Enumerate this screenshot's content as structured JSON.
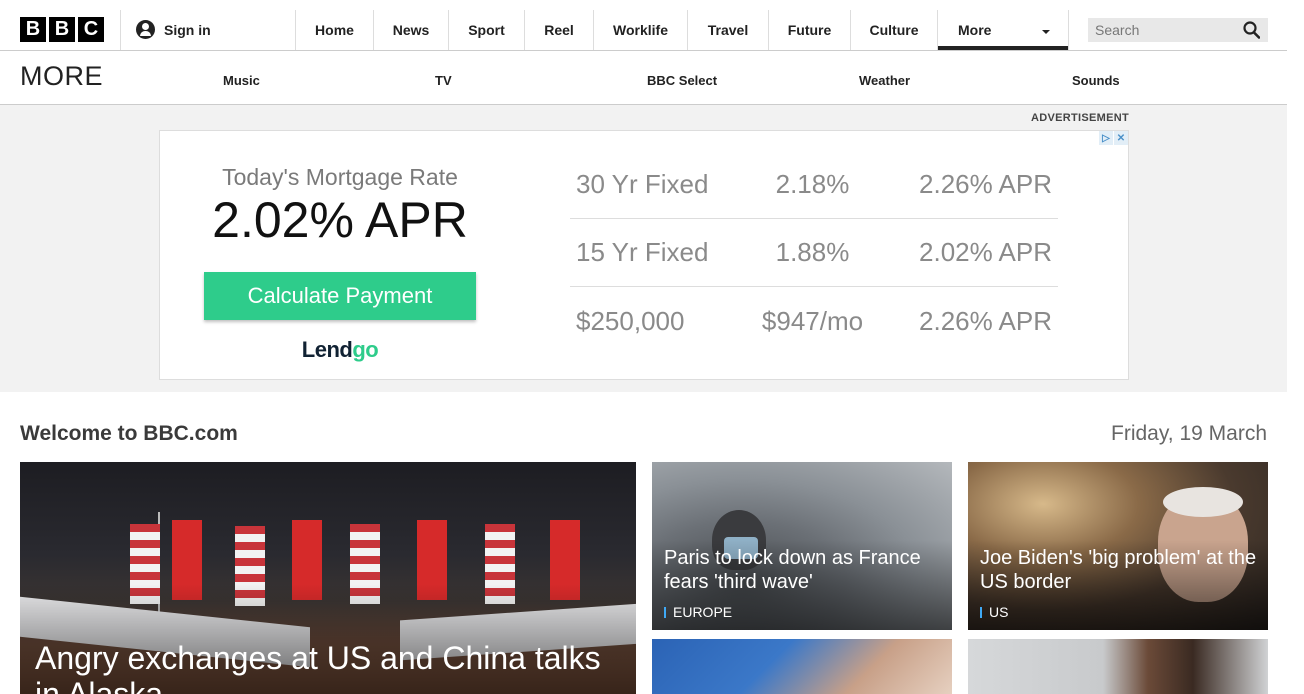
{
  "header": {
    "logo_letters": [
      "B",
      "B",
      "C"
    ],
    "signin_label": "Sign in",
    "nav": [
      "Home",
      "News",
      "Sport",
      "Reel",
      "Worklife",
      "Travel",
      "Future",
      "Culture",
      "More"
    ],
    "search_placeholder": "Search"
  },
  "subnav": {
    "title": "MORE",
    "links": [
      "Music",
      "TV",
      "BBC Select",
      "Weather",
      "Sounds"
    ]
  },
  "ad": {
    "label": "ADVERTISEMENT",
    "heading": "Today's Mortgage Rate",
    "rate": "2.02% APR",
    "button": "Calculate Payment",
    "brand_part1": "Lend",
    "brand_part2": "go",
    "rows": [
      [
        "30 Yr Fixed",
        "2.18%",
        "2.26% APR"
      ],
      [
        "15 Yr Fixed",
        "1.88%",
        "2.02% APR"
      ],
      [
        "$250,000",
        "$947/mo",
        "2.26% APR"
      ]
    ]
  },
  "main": {
    "welcome": "Welcome to BBC.com",
    "date": "Friday, 19 March",
    "stories": [
      {
        "headline": "Angry exchanges at US and China talks in Alaska"
      },
      {
        "headline": "Paris to lock down as France fears 'third wave'",
        "tag": "EUROPE"
      },
      {
        "headline": "Joe Biden's 'big problem' at the US border",
        "tag": "US"
      }
    ]
  }
}
